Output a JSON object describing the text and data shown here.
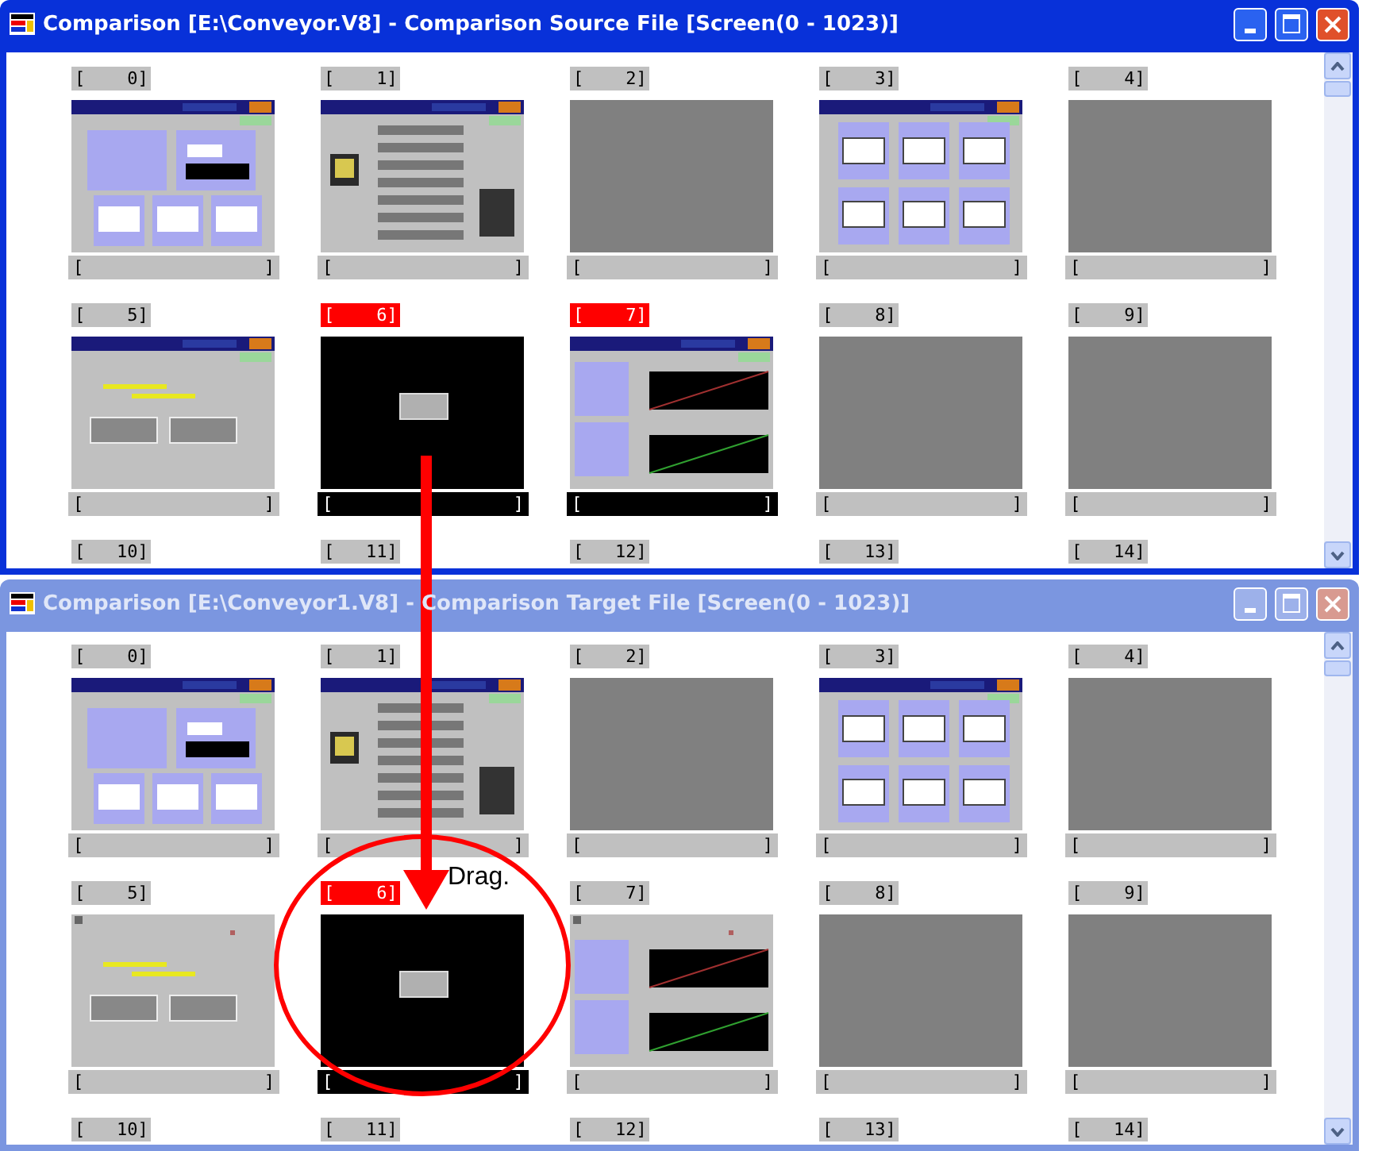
{
  "windows": [
    {
      "title": "Comparison [E:\\Conveyor.V8] - Comparison Source File [Screen(0 - 1023)]",
      "active": true,
      "cells": [
        {
          "label": "[    0]",
          "flagged": false,
          "kind": "monitor",
          "caption_left": "[",
          "caption_right": "]"
        },
        {
          "label": "[    1]",
          "flagged": false,
          "kind": "menu",
          "caption_left": "[",
          "caption_right": "]"
        },
        {
          "label": "[    2]",
          "flagged": false,
          "kind": "blank",
          "caption_left": "[",
          "caption_right": "]"
        },
        {
          "label": "[    3]",
          "flagged": false,
          "kind": "meters",
          "caption_left": "[",
          "caption_right": "]"
        },
        {
          "label": "[    4]",
          "flagged": false,
          "kind": "blank",
          "caption_left": "[",
          "caption_right": "]"
        },
        {
          "label": "[    5]",
          "flagged": false,
          "kind": "language",
          "caption_left": "[",
          "caption_right": "]"
        },
        {
          "label": "[    6]",
          "flagged": true,
          "kind": "black",
          "caption_left": "[",
          "caption_right": "]"
        },
        {
          "label": "[    7]",
          "flagged": true,
          "kind": "trend",
          "caption_left": "[",
          "caption_right": "]"
        },
        {
          "label": "[    8]",
          "flagged": false,
          "kind": "blank",
          "caption_left": "[",
          "caption_right": "]"
        },
        {
          "label": "[    9]",
          "flagged": false,
          "kind": "blank",
          "caption_left": "[",
          "caption_right": "]"
        }
      ],
      "next_row_labels": [
        "[   10]",
        "[   11]",
        "[   12]",
        "[   13]",
        "[   14]"
      ]
    },
    {
      "title": "Comparison [E:\\Conveyor1.V8] - Comparison Target File [Screen(0 - 1023)]",
      "active": false,
      "cells": [
        {
          "label": "[    0]",
          "flagged": false,
          "kind": "monitor",
          "caption_left": "[",
          "caption_right": "]"
        },
        {
          "label": "[    1]",
          "flagged": false,
          "kind": "menu",
          "caption_left": "[",
          "caption_right": "]"
        },
        {
          "label": "[    2]",
          "flagged": false,
          "kind": "blank",
          "caption_left": "[",
          "caption_right": "]"
        },
        {
          "label": "[    3]",
          "flagged": false,
          "kind": "meters",
          "caption_left": "[",
          "caption_right": "]"
        },
        {
          "label": "[    4]",
          "flagged": false,
          "kind": "blank",
          "caption_left": "[",
          "caption_right": "]"
        },
        {
          "label": "[    5]",
          "flagged": false,
          "kind": "language_plain",
          "caption_left": "[",
          "caption_right": "]"
        },
        {
          "label": "[    6]",
          "flagged": true,
          "kind": "black",
          "caption_left": "[",
          "caption_right": "]"
        },
        {
          "label": "[    7]",
          "flagged": false,
          "kind": "trend_plain",
          "caption_left": "[",
          "caption_right": "]"
        },
        {
          "label": "[    8]",
          "flagged": false,
          "kind": "blank",
          "caption_left": "[",
          "caption_right": "]"
        },
        {
          "label": "[    9]",
          "flagged": false,
          "kind": "blank",
          "caption_left": "[",
          "caption_right": "]"
        }
      ],
      "next_row_labels": [
        "[   10]",
        "[   11]",
        "[   12]",
        "[   13]",
        "[   14]"
      ]
    }
  ],
  "annotation": {
    "text": "Drag."
  }
}
